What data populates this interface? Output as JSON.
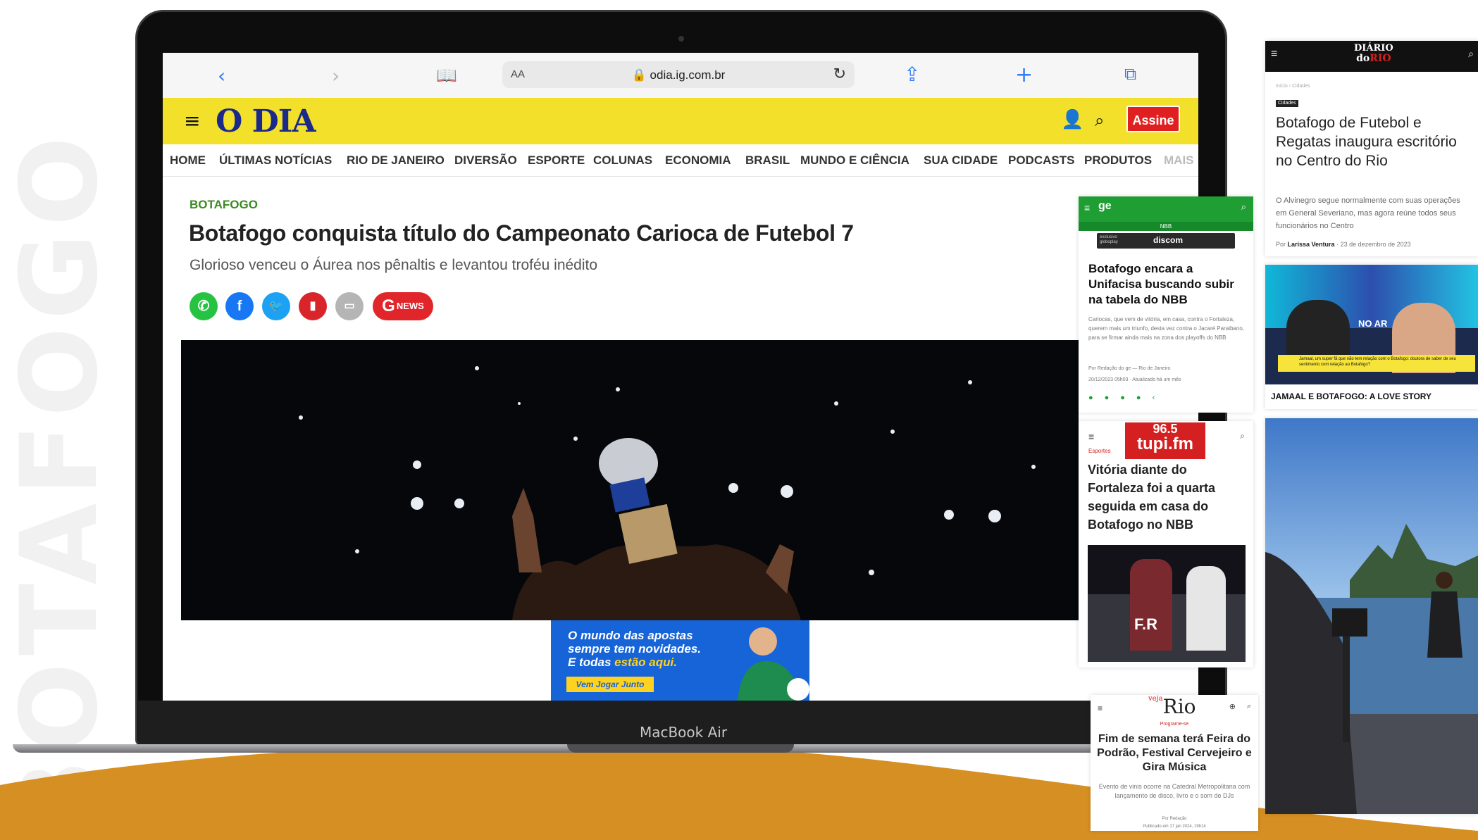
{
  "browser": {
    "text_size_label": "AA",
    "url": "odia.ig.com.br"
  },
  "odia": {
    "logo": "O DIA",
    "subscribe_label": "Assine",
    "nav": [
      "HOME",
      "ÚLTIMAS NOTÍCIAS",
      "RIO DE JANEIRO",
      "DIVERSÃO",
      "ESPORTE",
      "COLUNAS",
      "ECONOMIA",
      "BRASIL",
      "MUNDO E CIÊNCIA",
      "SUA CIDADE",
      "PODCASTS",
      "PRODUTOS",
      "MAIS"
    ],
    "article": {
      "kicker": "BOTAFOGO",
      "headline": "Botafogo conquista título do Campeonato Carioca de Futebol 7",
      "subheadline": "Glorioso venceu o Áurea nos pênaltis e levantou troféu inédito"
    },
    "gnews_label": "NEWS",
    "ad": {
      "line1": "O mundo das apostas",
      "line2": "sempre tem novidades.",
      "line3_a": "E todas",
      "line3_b": "estão aqui.",
      "button": "Vem Jogar Junto"
    }
  },
  "laptop_label": "MacBook Air",
  "ge_card": {
    "logo": "ge",
    "section": "NBB",
    "promo_left": "exclusivo globoplay",
    "promo_center": "discom",
    "headline": "Botafogo encara a Unifacisa buscando subir na tabela do NBB",
    "summary": "Cariocas, que vem de vitória, em casa, contra o Fortaleza, querem mais um triunfo, desta vez contra o Jacaré Paraibano, para se firmar ainda mais na zona dos playoffs do NBB",
    "byline": "Por Redação do ge — Rio de Janeiro",
    "date": "20/12/2023 05h03 · Atualizado há um mês"
  },
  "tupi_card": {
    "logo_top": "96.5",
    "logo_bottom": "tupi.fm",
    "section": "Esportes",
    "headline": "Vitória diante do Fortaleza foi a quarta seguida em casa do Botafogo no NBB",
    "photo_text": "F.R"
  },
  "vejario_card": {
    "logo_small": "veja",
    "logo": "Rio",
    "section": "Programe-se",
    "headline": "Fim de semana terá Feira do Podrão, Festival Cervejeiro e Gira Música",
    "summary": "Evento de vinis ocorre na Catedral Metropolitana com lançamento de disco, livro e o som de DJs",
    "byline": "Por Redação",
    "date": "Publicado em 17 jan 2024, 19h14"
  },
  "diario_card": {
    "logo_top": "DIÁRIO",
    "logo_bottom_a": "do",
    "logo_bottom_b": "RIO",
    "breadcrumb": "Início  ›  Cidades",
    "tag": "Cidades",
    "headline": "Botafogo de Futebol e Regatas inaugura escritório no Centro do Rio",
    "summary": "O Alvinegro segue normalmente com suas operações em General Severiano, mas agora reúne todos seus funcionários no Centro",
    "byline_prefix": "Por",
    "byline_name": "Larissa Ventura",
    "date": "23 de dezembro de 2023"
  },
  "video_card": {
    "overlay_text": "NO AR",
    "caption": "JAMAAL E BOTAFOGO: A LOVE STORY",
    "ticker": "Jamaal, um super fã que não tem relação com o Botafogo: doutora de saber de seu sentimento com relação ao Botafogo?"
  },
  "watermark": "BOTAFOGO",
  "colors": {
    "odia_yellow": "#f2e02a",
    "odia_blue": "#1b2a8a",
    "ge_green": "#1f9e33",
    "tupi_red": "#d42020",
    "brand_orange": "#d68f22"
  }
}
